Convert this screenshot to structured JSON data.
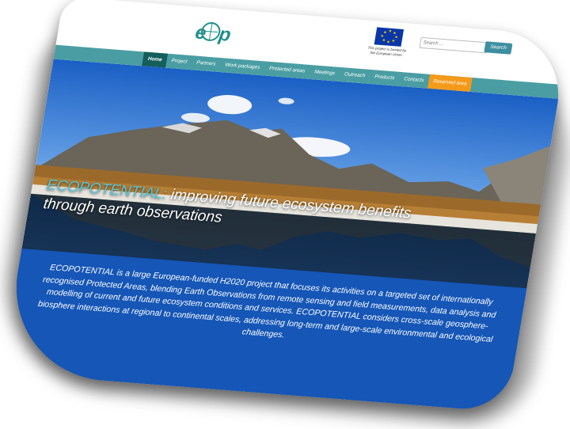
{
  "header": {
    "eu_funding_text": "This project is funded by the European Union",
    "search": {
      "placeholder": "Search ...",
      "button_label": "Search"
    }
  },
  "nav": {
    "items": [
      {
        "label": "Home",
        "state": "active"
      },
      {
        "label": "Project"
      },
      {
        "label": "Partners"
      },
      {
        "label": "Work packages"
      },
      {
        "label": "Protected areas"
      },
      {
        "label": "Meetings"
      },
      {
        "label": "Outreach"
      },
      {
        "label": "Products"
      },
      {
        "label": "Contacts"
      },
      {
        "label": "Reserved area",
        "state": "highlighted"
      }
    ]
  },
  "hero": {
    "title_accent": "ECOPOTENTIAL:",
    "title_rest": " improving future ecosystem benefits through earth observations",
    "description": "ECOPOTENTIAL is a large European-funded H2020 project that focuses its activities on a targeted set of internationally recognised Protected Areas, blending Earth Observations from remote sensing and field measurements, data analysis and modelling of current and future ecosystem conditions and services. ECOPOTENTIAL considers cross-scale geosphere-biosphere interactions at regional to continental scales, addressing long-term and large-scale environmental and ecological challenges."
  },
  "colors": {
    "nav_bg": "#4a9ea3",
    "nav_active": "#145e5c",
    "nav_reserved": "#f49a1a",
    "band_bg": "#1556b7",
    "title_accent": "#55c3d8",
    "search_button": "#3d8fa0",
    "eu_flag": "#0a36a8"
  }
}
